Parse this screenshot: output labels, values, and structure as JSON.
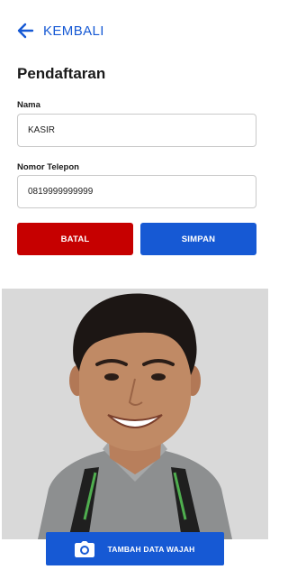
{
  "header": {
    "back_label": "KEMBALI"
  },
  "page_title": "Pendaftaran",
  "form": {
    "name_label": "Nama",
    "name_value": "KASIR",
    "phone_label": "Nomor Telepon",
    "phone_value": "0819999999999"
  },
  "buttons": {
    "cancel_label": "BATAL",
    "save_label": "SIMPAN",
    "add_face_label": "TAMBAH DATA WAJAH"
  },
  "icons": {
    "back": "arrow-left-icon",
    "camera": "camera-icon"
  },
  "colors": {
    "primary": "#1659d4",
    "danger": "#c60000",
    "photo_background": "#d9d9d9"
  }
}
